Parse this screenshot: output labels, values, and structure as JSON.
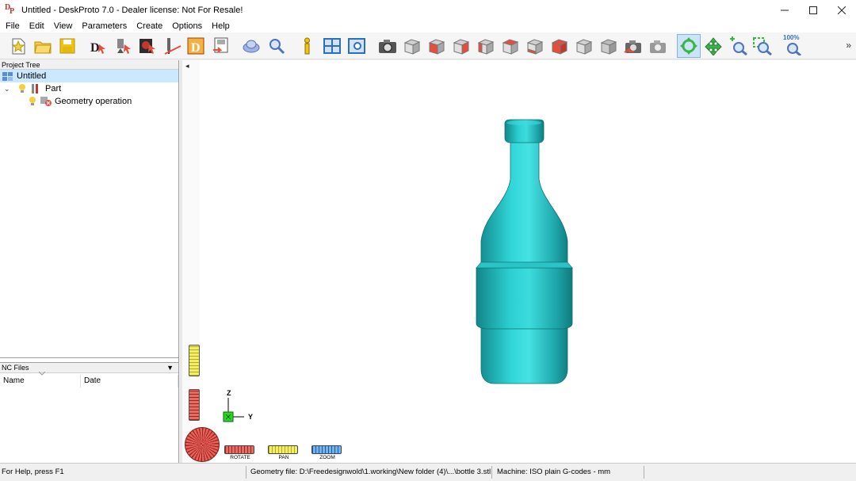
{
  "window": {
    "title": "Untitled - DeskProto 7.0 - Dealer license: Not For Resale!",
    "icon": "deskproto-app-icon",
    "controls": [
      "minimize",
      "maximize",
      "close"
    ]
  },
  "menu": [
    "File",
    "Edit",
    "View",
    "Parameters",
    "Create",
    "Options",
    "Help"
  ],
  "toolbar": {
    "groups": [
      [
        "new-project",
        "open-project",
        "save-project"
      ],
      [
        "wizard-geometry",
        "wizard-vector",
        "wizard-bitmap",
        "wizard-cut",
        "wizard-distance",
        "wizard-export"
      ],
      [
        "cutter-tool",
        "find-tool"
      ],
      [
        "info",
        "views-window",
        "split-view"
      ],
      [
        "snapshot",
        "view-front",
        "view-back",
        "view-left",
        "view-right",
        "view-top",
        "view-bottom",
        "view-iso",
        "view-iso-2",
        "render-toggle",
        "render-toggle-2"
      ],
      [
        "rotate-mode",
        "pan-mode",
        "zoom-mode",
        "zoom-window",
        "zoom-100"
      ]
    ],
    "zoom_label": "100%",
    "overflow": "»"
  },
  "project_tree": {
    "header": "Project Tree",
    "items": [
      {
        "label": "Untitled",
        "level": 0,
        "selected": true
      },
      {
        "label": "Part",
        "level": 1,
        "expanded": true
      },
      {
        "label": "Geometry operation",
        "level": 2
      }
    ]
  },
  "nc_files": {
    "header": "NC Files",
    "columns": [
      "Name",
      "Date"
    ]
  },
  "viewport": {
    "collapse_arrow": "◂",
    "axis_labels": {
      "z": "Z",
      "y": "Y"
    },
    "controls": [
      {
        "label": "ROTATE",
        "color": "#d9403a"
      },
      {
        "label": "PAN",
        "color": "#f1e64a"
      },
      {
        "label": "ZOOM",
        "color": "#3f8fdc"
      }
    ],
    "model_color": "#23b7bb",
    "background": "#ffffff"
  },
  "statusbar": {
    "help": "For Help, press F1",
    "geometry_file": "Geometry file: D:\\Freedesignwold\\1.working\\New folder (4)\\...\\bottle 3.stl",
    "machine": "Machine: ISO plain G-codes - mm"
  }
}
